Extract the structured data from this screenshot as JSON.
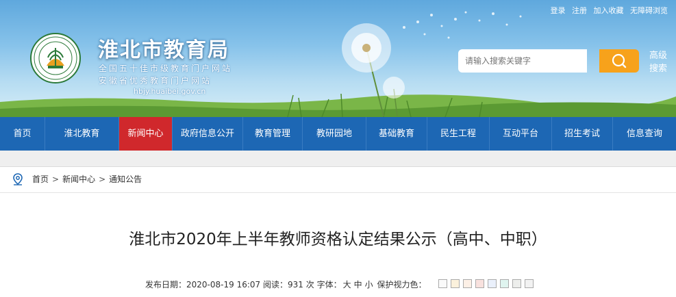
{
  "topbar": {
    "login": "登录",
    "register": "注册",
    "favorite": "加入收藏",
    "accessible": "无障碍浏览"
  },
  "site": {
    "title": "淮北市教育局",
    "subtitle1": "全国五十佳市级教育门户网站",
    "subtitle2": "安徽省优秀教育门户网站",
    "domain": "hbjy.huaibei.gov.cn"
  },
  "search": {
    "placeholder": "请输入搜索关键字",
    "advanced_line1": "高级",
    "advanced_line2": "搜索"
  },
  "nav": [
    {
      "label": "首页"
    },
    {
      "label": "淮北教育"
    },
    {
      "label": "新闻中心"
    },
    {
      "label": "政府信息公开"
    },
    {
      "label": "教育管理"
    },
    {
      "label": "教研园地"
    },
    {
      "label": "基础教育"
    },
    {
      "label": "民生工程"
    },
    {
      "label": "互动平台"
    },
    {
      "label": "招生考试"
    },
    {
      "label": "信息查询"
    }
  ],
  "breadcrumb": {
    "home": "首页",
    "sep": ">",
    "news": "新闻中心",
    "notice": "通知公告"
  },
  "article": {
    "title": "淮北市2020年上半年教师资格认定结果公示（高中、中职）",
    "date_label": "发布日期：",
    "date": "2020-08-19 16:07",
    "read_label": "阅读：",
    "read_count": "931",
    "read_unit": "次",
    "font_label": "字体：",
    "font_large": "大",
    "font_medium": "中",
    "font_small": "小",
    "eye_label": "保护视力色："
  },
  "colors": {
    "nav_bg": "#1d67b4",
    "nav_active": "#d0282c",
    "search_btn": "#f7a21b",
    "swatches": [
      "#fafafa",
      "#fbf1dc",
      "#fdf0e6",
      "#f8e1de",
      "#eaf0fb",
      "#dff4ef",
      "#edeeec",
      "#f2f2f2"
    ]
  }
}
